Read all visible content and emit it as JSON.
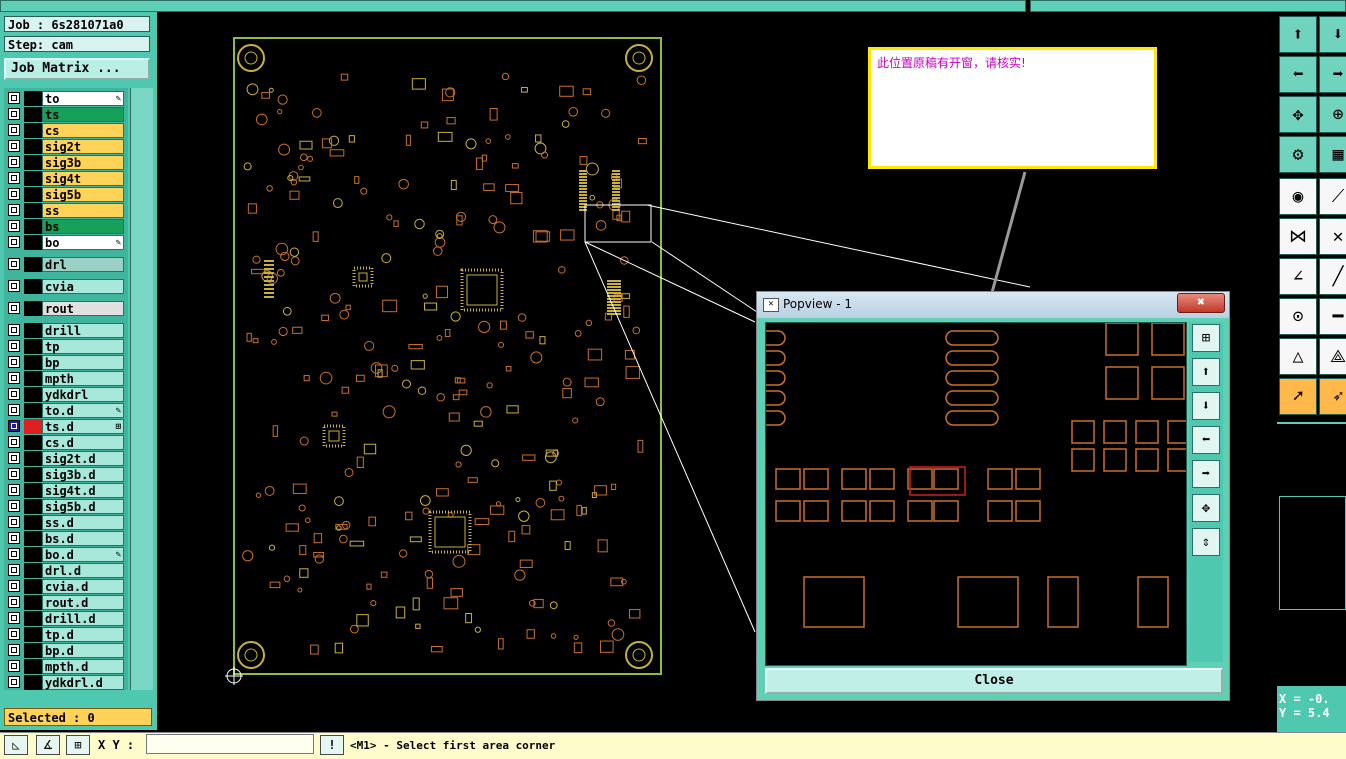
{
  "job": {
    "label": "Job : 6s281071a0",
    "step": "Step: cam",
    "matrix_button": "Job Matrix ..."
  },
  "layers": [
    {
      "name": "to",
      "color": "#ffffff",
      "mark": "✎",
      "checked": false
    },
    {
      "name": "ts",
      "color": "#17a05a",
      "mark": "",
      "checked": false
    },
    {
      "name": "cs",
      "color": "#ffd25a",
      "mark": "",
      "checked": false
    },
    {
      "name": "sig2t",
      "color": "#ffd25a",
      "mark": "",
      "checked": false
    },
    {
      "name": "sig3b",
      "color": "#ffd25a",
      "mark": "",
      "checked": false
    },
    {
      "name": "sig4t",
      "color": "#ffd25a",
      "mark": "",
      "checked": false
    },
    {
      "name": "sig5b",
      "color": "#ffd25a",
      "mark": "",
      "checked": false
    },
    {
      "name": "ss",
      "color": "#ffd25a",
      "mark": "",
      "checked": false
    },
    {
      "name": "bs",
      "color": "#17a05a",
      "mark": "",
      "checked": false
    },
    {
      "name": "bo",
      "color": "#ffffff",
      "mark": "✎",
      "checked": false
    },
    {
      "name": "drl",
      "color": "#9ad0c6",
      "mark": "",
      "checked": false
    },
    {
      "name": "cvia",
      "color": "#a8e8da",
      "mark": "",
      "checked": false
    },
    {
      "name": "rout",
      "color": "#e0e0e0",
      "mark": "",
      "checked": false
    },
    {
      "name": "drill",
      "color": "#a8e8da",
      "mark": "",
      "checked": false
    },
    {
      "name": "tp",
      "color": "#a8e8da",
      "mark": "",
      "checked": false
    },
    {
      "name": "bp",
      "color": "#a8e8da",
      "mark": "",
      "checked": false
    },
    {
      "name": "mpth",
      "color": "#a8e8da",
      "mark": "",
      "checked": false
    },
    {
      "name": "ydkdrl",
      "color": "#a8e8da",
      "mark": "",
      "checked": false
    },
    {
      "name": "to.d",
      "color": "#a8e8da",
      "mark": "✎",
      "checked": false
    },
    {
      "name": "ts.d",
      "color": "#a8e8da",
      "mark": "⊞",
      "checked": true
    },
    {
      "name": "cs.d",
      "color": "#a8e8da",
      "mark": "",
      "checked": false
    },
    {
      "name": "sig2t.d",
      "color": "#a8e8da",
      "mark": "",
      "checked": false
    },
    {
      "name": "sig3b.d",
      "color": "#a8e8da",
      "mark": "",
      "checked": false
    },
    {
      "name": "sig4t.d",
      "color": "#a8e8da",
      "mark": "",
      "checked": false
    },
    {
      "name": "sig5b.d",
      "color": "#a8e8da",
      "mark": "",
      "checked": false
    },
    {
      "name": "ss.d",
      "color": "#a8e8da",
      "mark": "",
      "checked": false
    },
    {
      "name": "bs.d",
      "color": "#a8e8da",
      "mark": "",
      "checked": false
    },
    {
      "name": "bo.d",
      "color": "#a8e8da",
      "mark": "✎",
      "checked": false
    },
    {
      "name": "drl.d",
      "color": "#a8e8da",
      "mark": "",
      "checked": false
    },
    {
      "name": "cvia.d",
      "color": "#a8e8da",
      "mark": "",
      "checked": false
    },
    {
      "name": "rout.d",
      "color": "#a8e8da",
      "mark": "",
      "checked": false
    },
    {
      "name": "drill.d",
      "color": "#a8e8da",
      "mark": "",
      "checked": false
    },
    {
      "name": "tp.d",
      "color": "#a8e8da",
      "mark": "",
      "checked": false
    },
    {
      "name": "bp.d",
      "color": "#a8e8da",
      "mark": "",
      "checked": false
    },
    {
      "name": "mpth.d",
      "color": "#a8e8da",
      "mark": "",
      "checked": false
    },
    {
      "name": "ydkdrl.d",
      "color": "#a8e8da",
      "mark": "",
      "checked": false
    }
  ],
  "selected_label": "Selected : 0",
  "bottom": {
    "xy_label": "X Y :",
    "xy_value": "",
    "warn_icon": "!",
    "prompt": "<M1> - Select first area corner"
  },
  "popview": {
    "title": "Popview - 1",
    "close_x": "✖",
    "close_label": "Close"
  },
  "note": {
    "text": "此位置原稿有开窗，请核实!"
  },
  "coords": {
    "x": "X = -0.",
    "y": "Y = 5.4"
  },
  "colors": {
    "panel": "#4fc8b0",
    "board_outline": "#8fbf3a",
    "pad_orange": "#c8702a",
    "pad_yellow": "#c8b040",
    "highlight": "#cc2020",
    "note_border": "#ffe800"
  }
}
